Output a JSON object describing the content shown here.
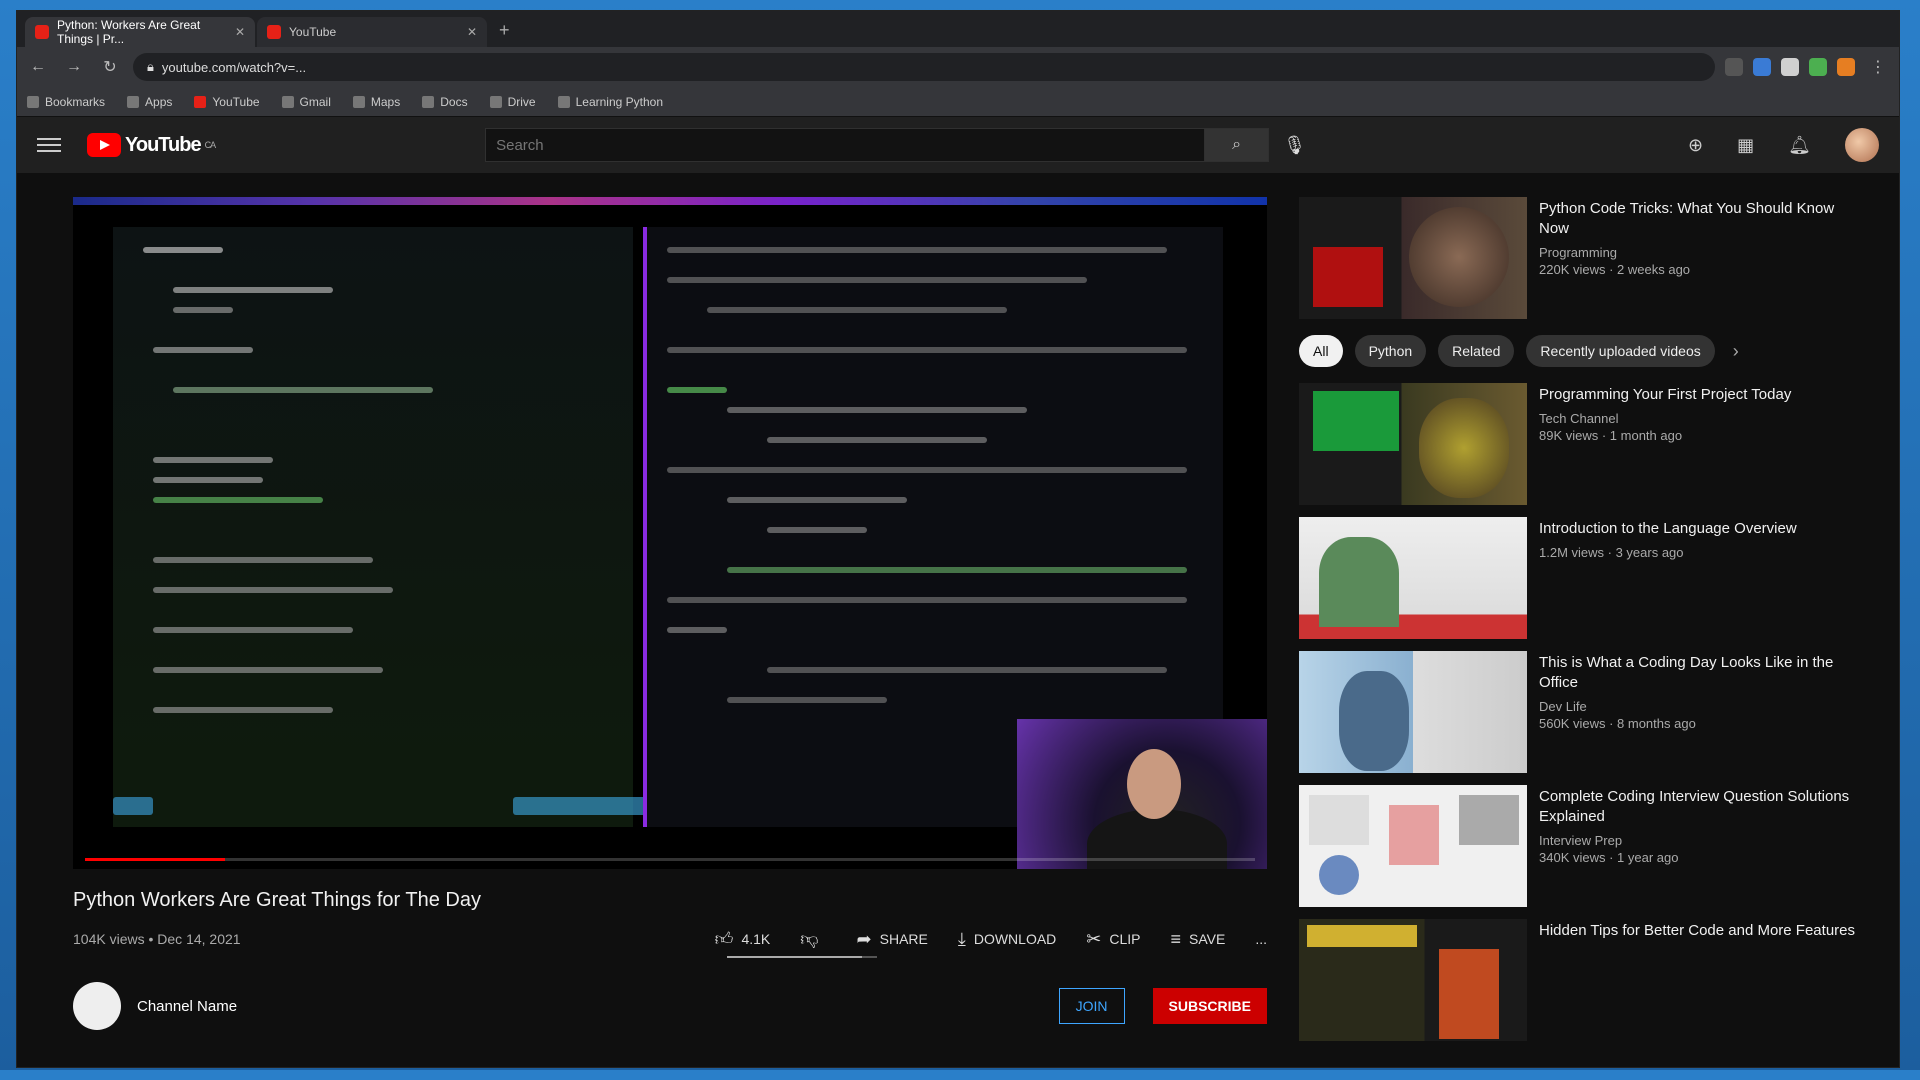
{
  "browser": {
    "tabs": [
      {
        "label": "Python: Workers Are Great Things | Pr...",
        "active": true
      },
      {
        "label": "YouTube",
        "active": false
      }
    ],
    "new_tab": "+",
    "url": "youtube.com/watch?v=...",
    "bookmarks": [
      "Bookmarks",
      "Apps",
      "YouTube",
      "Gmail",
      "Maps",
      "Docs",
      "Drive",
      "Learning Python"
    ]
  },
  "youtube": {
    "logo_text": "YouTube",
    "logo_region": "CA",
    "search_placeholder": "Search",
    "search_value": "",
    "header_icons": [
      "create-icon",
      "apps-icon",
      "bell-icon"
    ]
  },
  "video": {
    "title": "Python Workers Are Great Things for The Day",
    "views": "104K views",
    "date": "Dec 14, 2021",
    "likes": "4.1K",
    "dislike_label": "",
    "share_label": "SHARE",
    "download_label": "DOWNLOAD",
    "clip_label": "CLIP",
    "save_label": "SAVE",
    "more_label": "...",
    "like_ratio": 0.9,
    "progress": 0.12
  },
  "channel": {
    "name": "Channel Name",
    "join_label": "JOIN",
    "subscribe_label": "SUBSCRIBE"
  },
  "recommendations_top": [
    {
      "title": "Python Code Tricks: What You Should Know Now",
      "channel": "Programming",
      "stats": "220K views · 2 weeks ago"
    }
  ],
  "chips": [
    {
      "label": "All",
      "active": true
    },
    {
      "label": "Python",
      "active": false
    },
    {
      "label": "Related",
      "active": false
    },
    {
      "label": "Recently uploaded videos",
      "active": false
    }
  ],
  "recommendations": [
    {
      "title": "Programming Your First Project Today",
      "channel": "Tech Channel",
      "stats": "89K views · 1 month ago"
    },
    {
      "title": "Introduction to the Language Overview",
      "channel": "",
      "stats": "1.2M views · 3 years ago"
    },
    {
      "title": "This is What a Coding Day Looks Like in the Office",
      "channel": "Dev Life",
      "stats": "560K views · 8 months ago"
    },
    {
      "title": "Complete Coding Interview Question Solutions Explained",
      "channel": "Interview Prep",
      "stats": "340K views · 1 year ago"
    },
    {
      "title": "Hidden Tips for Better Code and More Features",
      "channel": "",
      "stats": ""
    }
  ],
  "colors": {
    "accent": "#ff0000",
    "background": "#0f0f0f",
    "link": "#3ea6ff"
  }
}
